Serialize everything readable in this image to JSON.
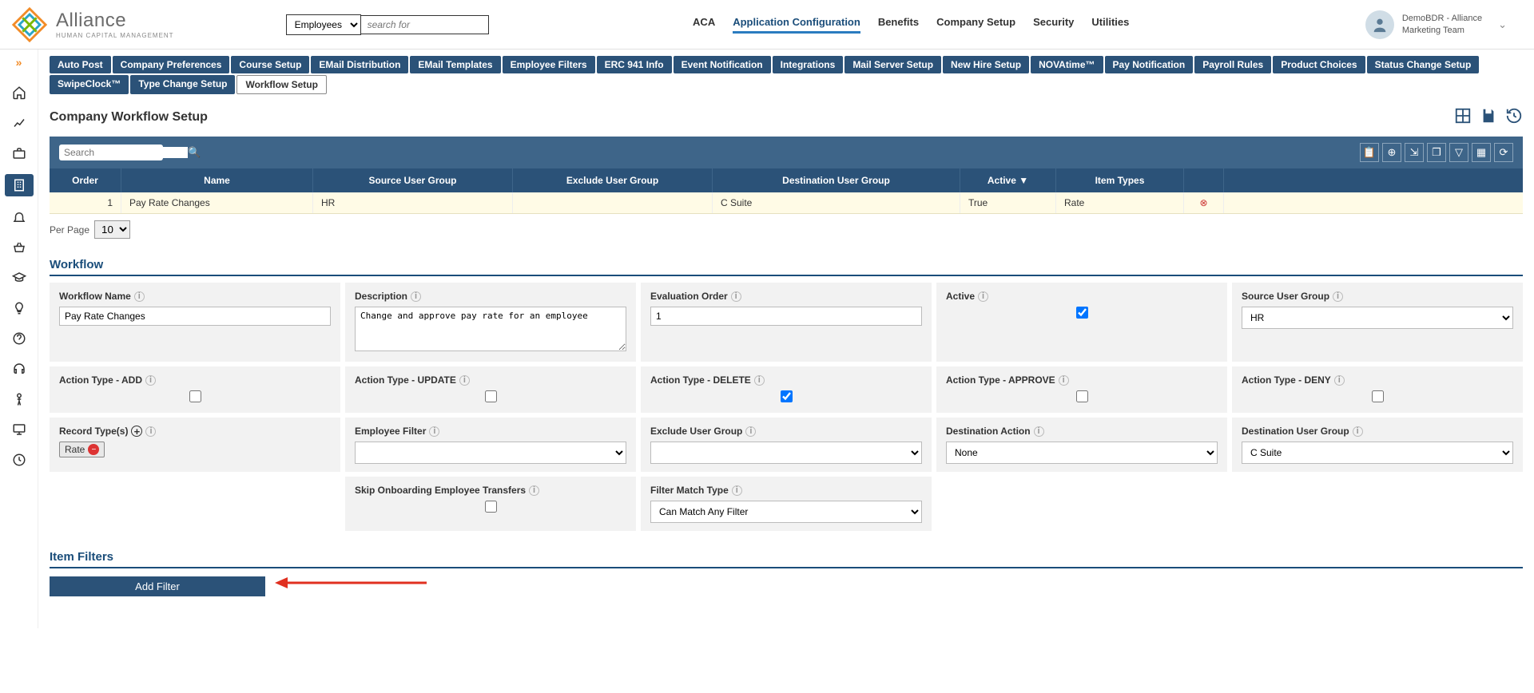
{
  "header": {
    "brand": "Alliance",
    "sub_brand": "HUMAN CAPITAL MANAGEMENT",
    "search_scope": "Employees",
    "search_placeholder": "search for",
    "nav": [
      "ACA",
      "Application Configuration",
      "Benefits",
      "Company Setup",
      "Security",
      "Utilities"
    ],
    "nav_active": "Application Configuration",
    "user_line1": "DemoBDR - Alliance",
    "user_line2": "Marketing Team"
  },
  "subtabs_row1": [
    "Auto Post",
    "Company Preferences",
    "Course Setup",
    "EMail Distribution",
    "EMail Templates",
    "Employee Filters",
    "ERC 941 Info",
    "Event Notification",
    "Integrations",
    "Mail Server Setup",
    "New Hire Setup",
    "NOVAtime™",
    "Pay Notification",
    "Payroll Rules",
    "Product Choices",
    "Status Change Setup"
  ],
  "subtabs_row2": [
    "SwipeClock™",
    "Type Change Setup",
    "Workflow Setup"
  ],
  "subtab_active": "Workflow Setup",
  "page_title": "Company Workflow Setup",
  "grid": {
    "search_placeholder": "Search",
    "columns": [
      "Order",
      "Name",
      "Source User Group",
      "Exclude User Group",
      "Destination User Group",
      "Active ▼",
      "Item Types"
    ],
    "rows": [
      {
        "order": "1",
        "name": "Pay Rate Changes",
        "source": "HR",
        "exclude": "",
        "dest": "C Suite",
        "active": "True",
        "item": "Rate"
      }
    ],
    "per_page_label": "Per Page",
    "per_page_value": "10"
  },
  "workflow_section": "Workflow",
  "fields": {
    "workflow_name_label": "Workflow Name",
    "workflow_name_value": "Pay Rate Changes",
    "description_label": "Description",
    "description_value": "Change and approve pay rate for an employee",
    "eval_order_label": "Evaluation Order",
    "eval_order_value": "1",
    "active_label": "Active",
    "source_group_label": "Source User Group",
    "source_group_value": "HR",
    "add_label": "Action Type - ADD",
    "update_label": "Action Type - UPDATE",
    "delete_label": "Action Type - DELETE",
    "approve_label": "Action Type - APPROVE",
    "deny_label": "Action Type - DENY",
    "record_types_label": "Record Type(s)",
    "record_tag": "Rate",
    "emp_filter_label": "Employee Filter",
    "exclude_group_label": "Exclude User Group",
    "dest_action_label": "Destination Action",
    "dest_action_value": "None",
    "dest_group_label": "Destination User Group",
    "dest_group_value": "C Suite",
    "skip_onboard_label": "Skip Onboarding Employee Transfers",
    "filter_match_label": "Filter Match Type",
    "filter_match_value": "Can Match Any Filter"
  },
  "item_filters_section": "Item Filters",
  "add_filter_label": "Add Filter"
}
